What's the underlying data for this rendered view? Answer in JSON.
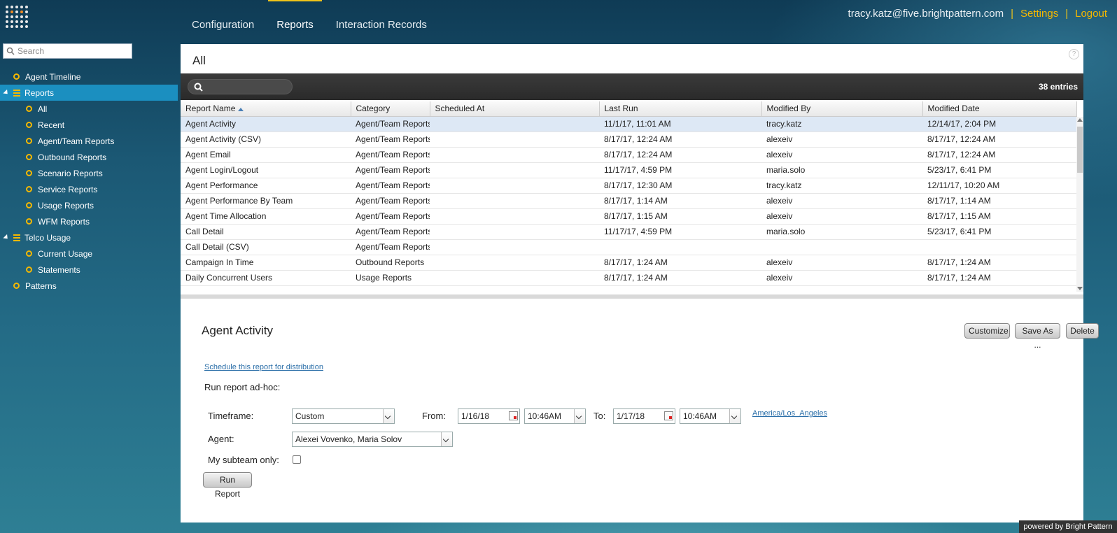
{
  "header": {
    "tabs": [
      {
        "label": "Configuration"
      },
      {
        "label": "Reports"
      },
      {
        "label": "Interaction Records"
      }
    ],
    "user_email": "tracy.katz@five.brightpattern.com",
    "sep1": "|",
    "settings_label": "Settings",
    "sep2": "|",
    "logout_label": "Logout"
  },
  "sidebar": {
    "search_placeholder": "Search",
    "items": [
      {
        "label": "Agent Timeline"
      },
      {
        "label": "Reports"
      },
      {
        "label": "All"
      },
      {
        "label": "Recent"
      },
      {
        "label": "Agent/Team Reports"
      },
      {
        "label": "Outbound Reports"
      },
      {
        "label": "Scenario Reports"
      },
      {
        "label": "Service Reports"
      },
      {
        "label": "Usage Reports"
      },
      {
        "label": "WFM Reports"
      },
      {
        "label": "Telco Usage"
      },
      {
        "label": "Current Usage"
      },
      {
        "label": "Statements"
      },
      {
        "label": "Patterns"
      }
    ]
  },
  "main": {
    "title": "All",
    "entries": "38 entries",
    "columns": [
      "Report Name",
      "Category",
      "Scheduled At",
      "Last Run",
      "Modified By",
      "Modified Date"
    ],
    "rows": [
      [
        "Agent Activity",
        "Agent/Team Reports",
        "",
        "11/1/17, 11:01 AM",
        "tracy.katz",
        "12/14/17, 2:04 PM"
      ],
      [
        "Agent Activity (CSV)",
        "Agent/Team Reports",
        "",
        "8/17/17, 12:24 AM",
        "alexeiv",
        "8/17/17, 12:24 AM"
      ],
      [
        "Agent Email",
        "Agent/Team Reports",
        "",
        "8/17/17, 12:24 AM",
        "alexeiv",
        "8/17/17, 12:24 AM"
      ],
      [
        "Agent Login/Logout",
        "Agent/Team Reports",
        "",
        "11/17/17, 4:59 PM",
        "maria.solo",
        "5/23/17, 6:41 PM"
      ],
      [
        "Agent Performance",
        "Agent/Team Reports",
        "",
        "8/17/17, 12:30 AM",
        "tracy.katz",
        "12/11/17, 10:20 AM"
      ],
      [
        "Agent Performance By Team",
        "Agent/Team Reports",
        "",
        "8/17/17, 1:14 AM",
        "alexeiv",
        "8/17/17, 1:14 AM"
      ],
      [
        "Agent Time Allocation",
        "Agent/Team Reports",
        "",
        "8/17/17, 1:15 AM",
        "alexeiv",
        "8/17/17, 1:15 AM"
      ],
      [
        "Call Detail",
        "Agent/Team Reports",
        "",
        "11/17/17, 4:59 PM",
        "maria.solo",
        "5/23/17, 6:41 PM"
      ],
      [
        "Call Detail (CSV)",
        "Agent/Team Reports",
        "",
        "",
        "",
        ""
      ],
      [
        "Campaign In Time",
        "Outbound Reports",
        "",
        "8/17/17, 1:24 AM",
        "alexeiv",
        "8/17/17, 1:24 AM"
      ],
      [
        "Daily Concurrent Users",
        "Usage Reports",
        "",
        "8/17/17, 1:24 AM",
        "alexeiv",
        "8/17/17, 1:24 AM"
      ]
    ]
  },
  "details": {
    "title": "Agent Activity",
    "customize_label": "Customize",
    "save_as_label": "Save As ...",
    "delete_label": "Delete",
    "schedule_link": "Schedule this report for distribution",
    "run_adhoc_label": "Run report ad-hoc:",
    "timeframe_label": "Timeframe:",
    "timeframe_value": "Custom",
    "from_label": "From:",
    "from_date": "1/16/18",
    "from_time": "10:46AM",
    "to_label": "To:",
    "to_date": "1/17/18",
    "to_time": "10:46AM",
    "timezone_link": "America/Los_Angeles",
    "agent_label": "Agent:",
    "agent_value": "Alexei Vovenko, Maria Solov",
    "subteam_label": "My subteam only:",
    "run_button": "Run Report"
  },
  "footer": {
    "powered_by": "powered by Bright Pattern"
  },
  "colors": {
    "accent": "#f5b800",
    "selected_nav": "#1b8fc0",
    "selected_row": "#dde8f5"
  }
}
